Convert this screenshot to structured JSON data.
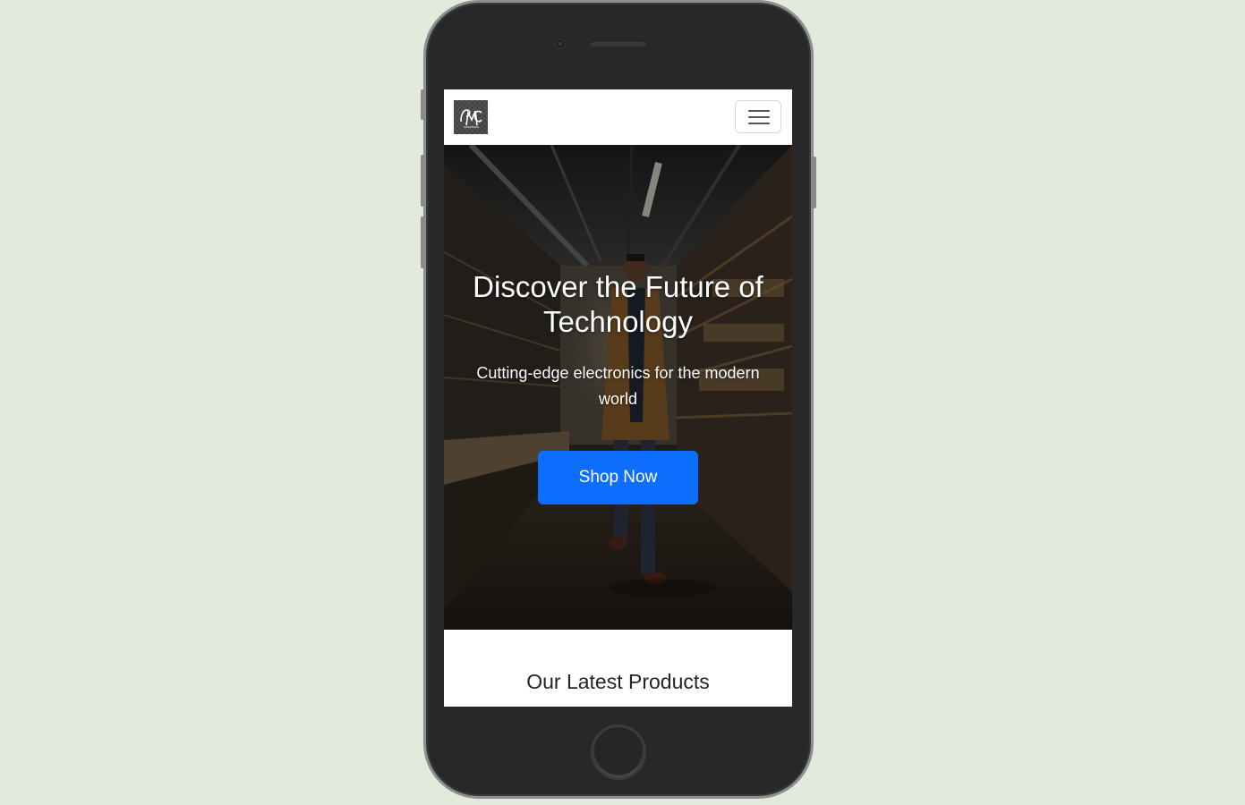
{
  "navbar": {
    "logo_icon": "brand-logo",
    "menu_icon": "hamburger-menu-icon"
  },
  "hero": {
    "title": "Discover the Future of Technology",
    "subtitle": "Cutting-edge electronics for the modern world",
    "cta_label": "Shop Now"
  },
  "products": {
    "section_title": "Our Latest Products"
  },
  "colors": {
    "background": "#e2eadb",
    "primary_button": "#0d6efd",
    "device_body": "#282828"
  }
}
